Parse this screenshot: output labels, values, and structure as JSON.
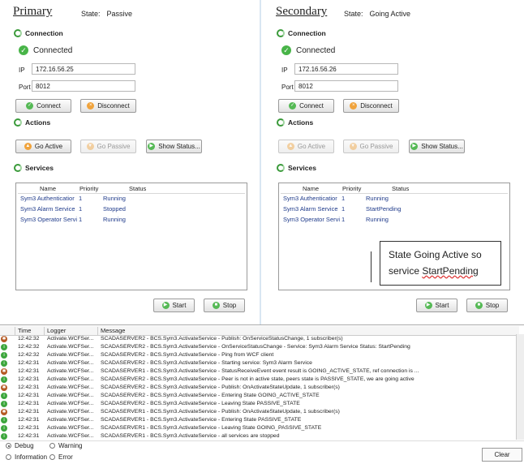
{
  "primary": {
    "title": "Primary",
    "state_label": "State:",
    "state_value": "Passive",
    "connection_title": "Connection",
    "connected_text": "Connected",
    "ip_label": "IP",
    "ip_value": "172.16.56.25",
    "port_label": "Port",
    "port_value": "8012",
    "connect_label": "Connect",
    "disconnect_label": "Disconnect",
    "actions_title": "Actions",
    "go_active_label": "Go Active",
    "go_passive_label": "Go Passive",
    "show_status_label": "Show Status...",
    "services_title": "Services",
    "columns": [
      "Name",
      "Priority",
      "Status"
    ],
    "services": [
      {
        "name": "Sym3 Authenticatior",
        "priority": "1",
        "status": "Running"
      },
      {
        "name": "Sym3 Alarm Service",
        "priority": "1",
        "status": "Stopped"
      },
      {
        "name": "Sym3 Operator Servi",
        "priority": "1",
        "status": "Running"
      }
    ],
    "start_label": "Start",
    "stop_label": "Stop"
  },
  "secondary": {
    "title": "Secondary",
    "state_label": "State:",
    "state_value": "Going Active",
    "connection_title": "Connection",
    "connected_text": "Connected",
    "ip_label": "IP",
    "ip_value": "172.16.56.26",
    "port_label": "Port",
    "port_value": "8012",
    "connect_label": "Connect",
    "disconnect_label": "Disconnect",
    "actions_title": "Actions",
    "go_active_label": "Go Active",
    "go_passive_label": "Go Passive",
    "show_status_label": "Show Status...",
    "services_title": "Services",
    "columns": [
      "Name",
      "Priority",
      "Status"
    ],
    "services": [
      {
        "name": "Sym3 Authenticatior",
        "priority": "1",
        "status": "Running"
      },
      {
        "name": "Sym3 Alarm Service",
        "priority": "1",
        "status": "StartPending"
      },
      {
        "name": "Sym3 Operator Servi",
        "priority": "1",
        "status": "Running"
      }
    ],
    "start_label": "Start",
    "stop_label": "Stop"
  },
  "callout": {
    "line1": "State Going Active so",
    "line2_prefix": "service ",
    "line2_word": "StartPending"
  },
  "log": {
    "columns": [
      "Time",
      "Logger",
      "Message"
    ],
    "rows": [
      {
        "icon": "bug",
        "time": "12:42:32",
        "logger": "Activate.WCFSer...",
        "message": "SCADASERVER2 - BCS.Sym3.ActivateService - Publish: OnServiceStatusChange, 1 subscriber(s)"
      },
      {
        "icon": "green",
        "time": "12:42:32",
        "logger": "Activate.WCFSer...",
        "message": "SCADASERVER2 - BCS.Sym3.ActivateService - OnServiceStatusChange - Service: Sym3 Alarm Service Status: StartPending"
      },
      {
        "icon": "green",
        "time": "12:42:32",
        "logger": "Activate.WCFSer...",
        "message": "SCADASERVER2 - BCS.Sym3.ActivateService - Ping from WCF client"
      },
      {
        "icon": "green",
        "time": "12:42:31",
        "logger": "Activate.WCFSer...",
        "message": "SCADASERVER2 - BCS.Sym3.ActivateService - Starting service: Sym3 Alarm Service"
      },
      {
        "icon": "bug",
        "time": "12:42:31",
        "logger": "Activate.WCFSer...",
        "message": "SCADASERVER1 - BCS.Sym3.ActivateService - StatusReceiveEvent event result is GOING_ACTIVE_STATE, ref connection is ..."
      },
      {
        "icon": "green",
        "time": "12:42:31",
        "logger": "Activate.WCFSer...",
        "message": "SCADASERVER2 - BCS.Sym3.ActivateService - Peer is not in active state, peers state is PASSIVE_STATE, we are going active"
      },
      {
        "icon": "bug",
        "time": "12:42:31",
        "logger": "Activate.WCFSer...",
        "message": "SCADASERVER2 - BCS.Sym3.ActivateService - Publish: OnActivateStateUpdate, 1 subscriber(s)"
      },
      {
        "icon": "green",
        "time": "12:42:31",
        "logger": "Activate.WCFSer...",
        "message": "SCADASERVER2 - BCS.Sym3.ActivateService - Entering State GOING_ACTIVE_STATE"
      },
      {
        "icon": "green",
        "time": "12:42:31",
        "logger": "Activate.WCFSer...",
        "message": "SCADASERVER2 - BCS.Sym3.ActivateService - Leaving State PASSIVE_STATE"
      },
      {
        "icon": "bug",
        "time": "12:42:31",
        "logger": "Activate.WCFSer...",
        "message": "SCADASERVER1 - BCS.Sym3.ActivateService - Publish: OnActivateStateUpdate, 1 subscriber(s)"
      },
      {
        "icon": "green",
        "time": "12:42:31",
        "logger": "Activate.WCFSer...",
        "message": "SCADASERVER1 - BCS.Sym3.ActivateService - Entering State PASSIVE_STATE"
      },
      {
        "icon": "green",
        "time": "12:42:31",
        "logger": "Activate.WCFSer...",
        "message": "SCADASERVER1 - BCS.Sym3.ActivateService - Leaving State GOING_PASSIVE_STATE"
      },
      {
        "icon": "green",
        "time": "12:42:31",
        "logger": "Activate.WCFSer...",
        "message": "SCADASERVER1 - BCS.Sym3.ActivateService - all services are stopped"
      }
    ]
  },
  "filters": {
    "debug": "Debug",
    "warning": "Warning",
    "information": "Information",
    "error": "Error"
  },
  "clear_label": "Clear",
  "colors": {
    "accent_green": "#48b448",
    "link_blue": "#1e3a8a"
  }
}
